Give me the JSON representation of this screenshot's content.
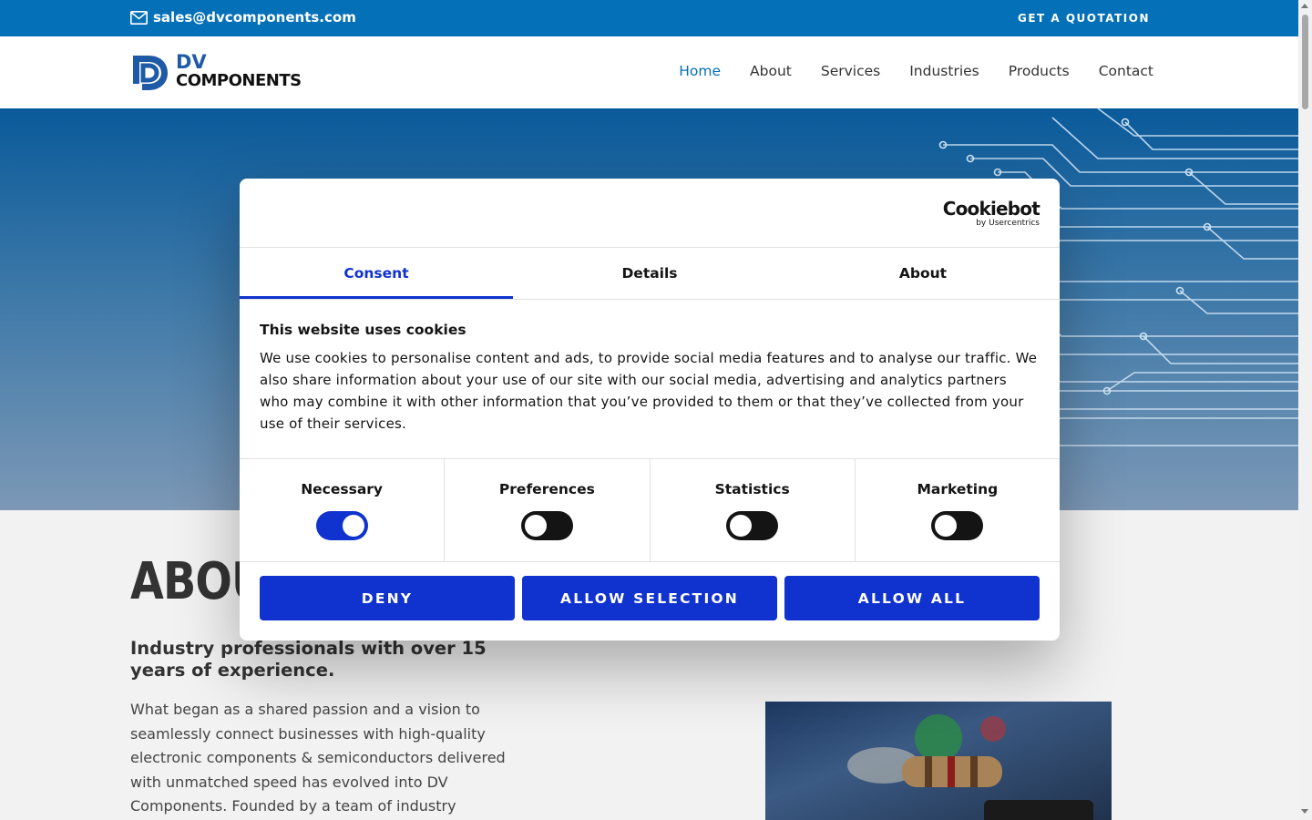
{
  "topbar": {
    "email": "sales@dvcomponents.com",
    "quote_label": "GET A QUOTATION"
  },
  "header": {
    "logo_line1": "DV",
    "logo_line2": "COMPONENTS",
    "nav": [
      "Home",
      "About",
      "Services",
      "Industries",
      "Products",
      "Contact"
    ],
    "active_nav": "Home"
  },
  "about": {
    "title": "ABOUT",
    "subtitle": "Industry professionals with over 15 years of experience.",
    "body": "What began as a shared passion and a vision to seamlessly connect businesses with high-quality electronic components & semiconductors delivered with unmatched speed has evolved into DV Components. Founded by a team of industry"
  },
  "cookie_dialog": {
    "brand": "Cookiebot",
    "brand_by": "by Usercentrics",
    "tabs": [
      "Consent",
      "Details",
      "About"
    ],
    "active_tab": "Consent",
    "heading": "This website uses cookies",
    "text": "We use cookies to personalise content and ads, to provide social media features and to analyse our traffic. We also share information about your use of our site with our social media, advertising and analytics partners who may combine it with other information that you’ve provided to them or that they’ve collected from your use of their services.",
    "toggles": [
      {
        "label": "Necessary",
        "on": true
      },
      {
        "label": "Preferences",
        "on": false
      },
      {
        "label": "Statistics",
        "on": false
      },
      {
        "label": "Marketing",
        "on": false
      }
    ],
    "buttons": {
      "deny": "DENY",
      "allow_selection": "ALLOW SELECTION",
      "allow_all": "ALLOW ALL"
    }
  },
  "colors": {
    "brand_blue": "#0470b8",
    "cookie_accent": "#1032cf"
  }
}
